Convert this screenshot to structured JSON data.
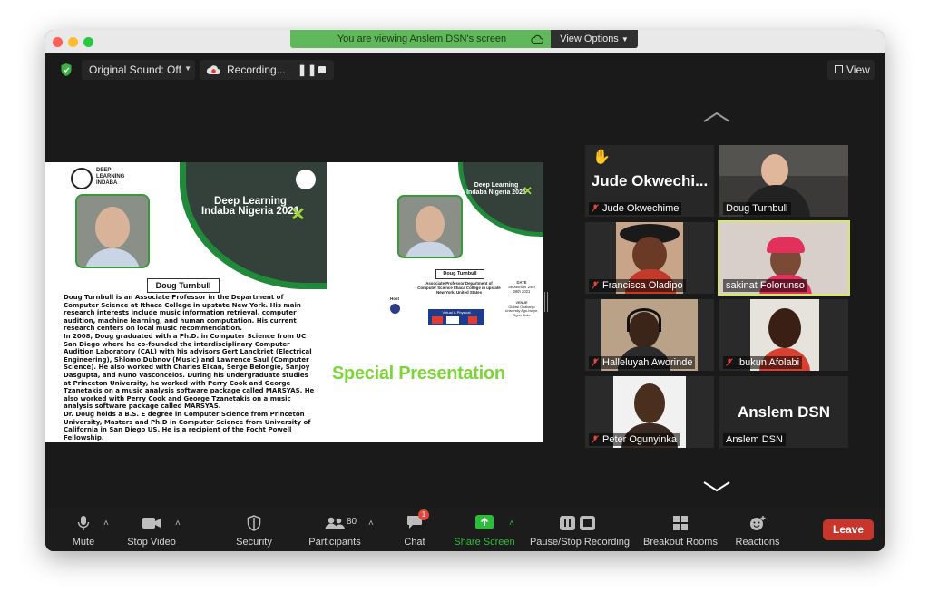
{
  "banner": {
    "text": "You are viewing Anslem DSN's screen",
    "view_options": "View Options"
  },
  "topbar": {
    "original_sound": "Original Sound: Off",
    "recording": "Recording...",
    "view": "View"
  },
  "slide_left": {
    "logo_text": "DEEP LEARNING INDABA",
    "event_title": "Deep Learning Indaba Nigeria 2021",
    "speaker_name": "Doug Turnbull",
    "bio_paragraphs": [
      "Doug Turnbull is an Associate Professor in the Department of Computer Science at Ithaca College in upstate New York. His main research interests include music information retrieval, computer audition, machine learning, and human computation.  His current research centers on local music recommendation.",
      "In 2008, Doug graduated with a Ph.D. in Computer Science from UC San Diego where he co-founded the interdisciplinary Computer Audition Laboratory (CAL) with his advisors Gert Lanckriet (Electrical Engineering), Shlomo Dubnov (Music) and Lawrence Saul (Computer Science). He also worked with Charles Elkan, Serge Belongie, Sanjoy Dasgupta, and Nuno Vasconcelos. During his undergraduate studies at Princeton University, he worked with Perry Cook and George Tzanetakis on a music analysis software package called MARSYAS. He also worked with Perry Cook and George Tzanetakis on a music analysis software package called MARSYAS.",
      "Dr. Doug holds a B.S. E degree in Computer Science from Princeton University, Masters and Ph.D  in Computer Science from University of California in San Diego US.  He is a recipient of the Focht Powell Fellowship."
    ]
  },
  "slide_right": {
    "event_title": "Deep Learning Indaba Nigeria 2021",
    "speaker_name": "Doug Turnbull",
    "speaker_role": "Associate Professor Department of Computer Science Ithaca College in upstate New York, United States",
    "date_label": "DATE",
    "date_value": "September 24th 26th 2021",
    "venue_label": "VENUE",
    "venue_value": "Olabisi Onabanjo University Ago-Iwoye, Ogun State",
    "host_label": "Host",
    "mode_label": "Virtual & Physical",
    "special": "Special Presentation"
  },
  "participants": [
    {
      "name": "Jude Okwechime",
      "display": "Jude Okwechi...",
      "muted": true,
      "raised_hand": true
    },
    {
      "name": "Doug Turnbull",
      "muted": false
    },
    {
      "name": "Francisca Oladipo",
      "muted": true
    },
    {
      "name": "sakinat Folorunso",
      "muted": false,
      "active": true
    },
    {
      "name": "Halleluyah Aworinde",
      "muted": true
    },
    {
      "name": "Ibukun Afolabi",
      "muted": true
    },
    {
      "name": "Peter Ogunyinka",
      "muted": true
    },
    {
      "name": "Anslem DSN",
      "display": "Anslem DSN",
      "muted": false
    }
  ],
  "toolbar": {
    "mute": "Mute",
    "stop_video": "Stop Video",
    "security": "Security",
    "participants": "Participants",
    "participants_count": "80",
    "chat": "Chat",
    "chat_badge": "1",
    "share_screen": "Share Screen",
    "recording": "Pause/Stop Recording",
    "breakout": "Breakout Rooms",
    "reactions": "Reactions",
    "leave": "Leave"
  },
  "colors": {
    "banner_green": "#5fb85a",
    "share_green": "#2dbd3a",
    "leave_red": "#c8352a",
    "active_border": "#d6e86a",
    "accent_green": "#9fd83a"
  }
}
